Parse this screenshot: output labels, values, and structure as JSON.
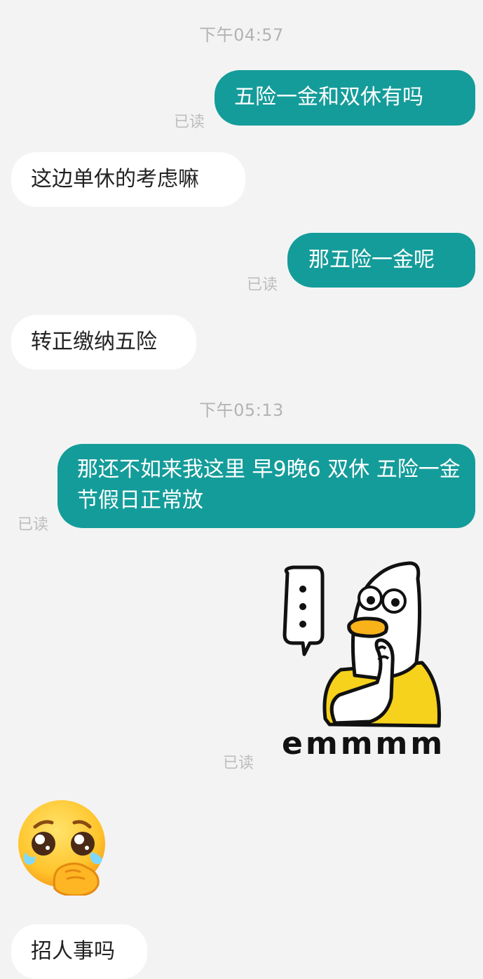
{
  "timestamps": [
    "下午04:57",
    "下午05:13"
  ],
  "read_label": "已读",
  "messages": [
    {
      "dir": "out",
      "text": "五险一金和双休有吗"
    },
    {
      "dir": "in",
      "text": "这边单休的考虑嘛"
    },
    {
      "dir": "out",
      "text": "那五险一金呢"
    },
    {
      "dir": "in",
      "text": "转正缴纳五险"
    },
    {
      "dir": "out",
      "text": "那还不如来我这里 早9晚6 双休 五险一金 节假日正常放"
    },
    {
      "dir": "in",
      "text": "招人事吗"
    }
  ],
  "sticker": {
    "caption": "emmmm",
    "bubble_text": "⋮"
  },
  "colors": {
    "outgoing_bubble": "#149c9a",
    "incoming_bubble": "#ffffff",
    "background": "#f3f3f3"
  }
}
